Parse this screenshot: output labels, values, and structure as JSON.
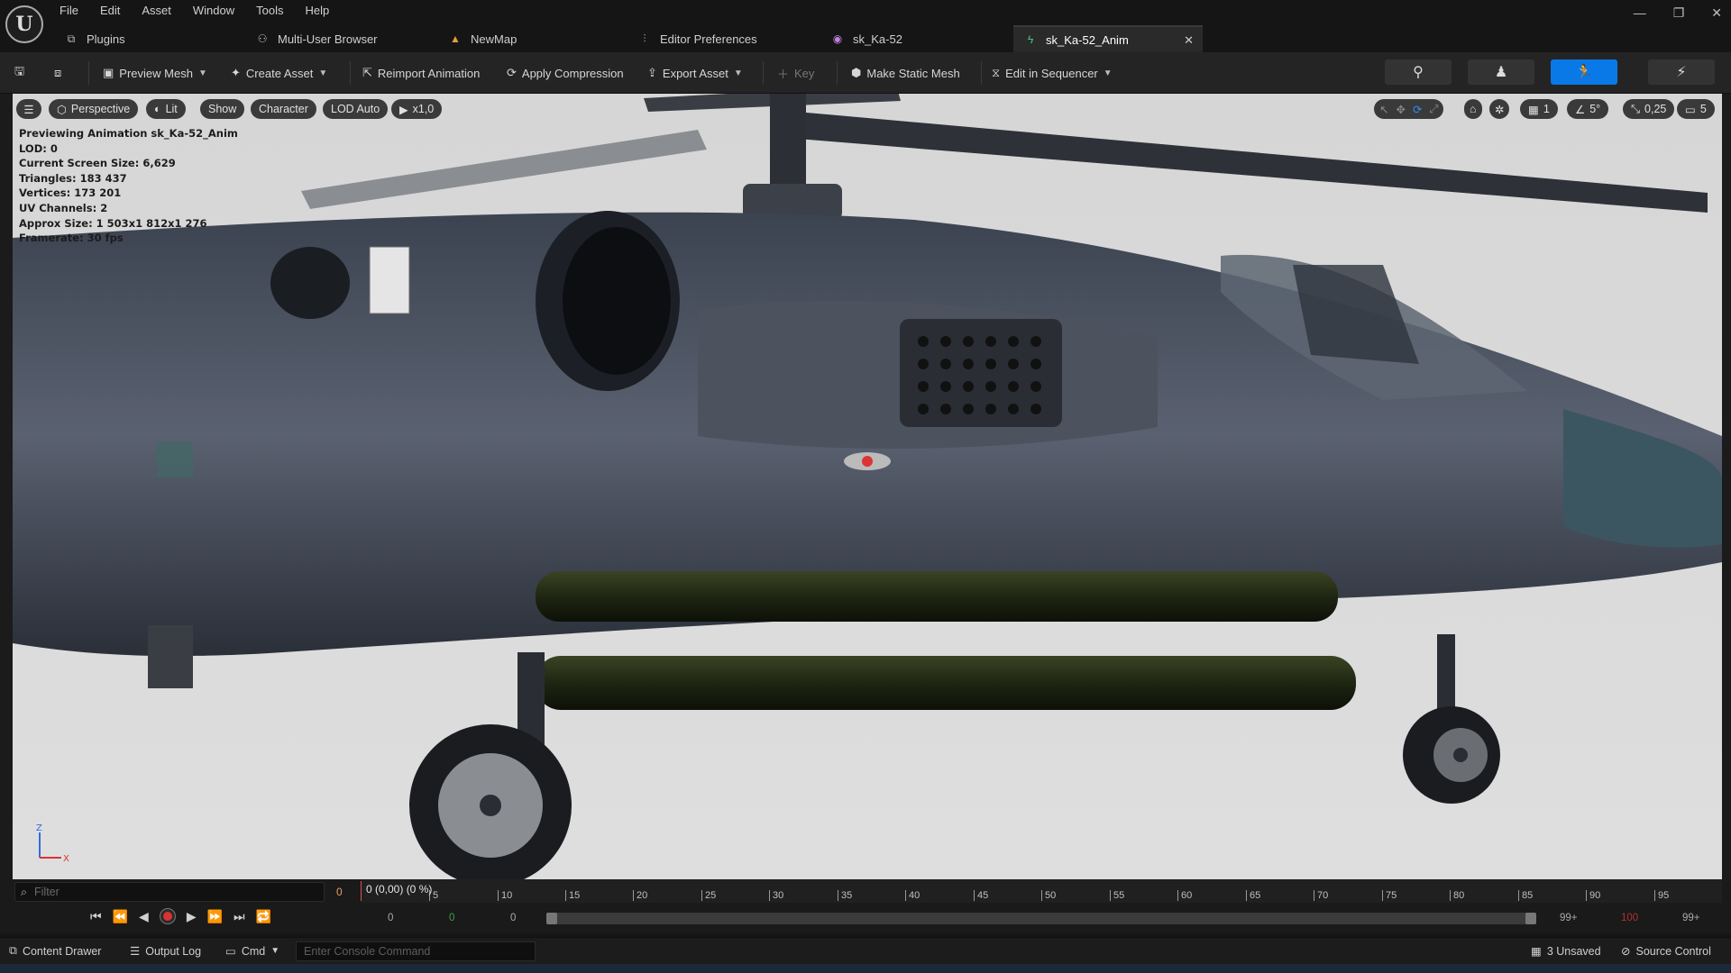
{
  "menu": [
    "File",
    "Edit",
    "Asset",
    "Window",
    "Tools",
    "Help"
  ],
  "tabs": [
    {
      "label": "Plugins",
      "icon": "plugin-icon"
    },
    {
      "label": "Multi-User Browser",
      "icon": "users-icon"
    },
    {
      "label": "NewMap",
      "icon": "map-icon"
    },
    {
      "label": "Editor Preferences",
      "icon": "sliders-icon"
    },
    {
      "label": "sk_Ka-52",
      "icon": "skeleton-icon"
    },
    {
      "label": "sk_Ka-52_Anim",
      "icon": "animation-icon",
      "active": true
    }
  ],
  "toolbar": {
    "preview_mesh": "Preview Mesh",
    "create_asset": "Create Asset",
    "reimport": "Reimport Animation",
    "apply_compression": "Apply Compression",
    "export_asset": "Export Asset",
    "key": "Key",
    "make_static_mesh": "Make Static Mesh",
    "edit_in_sequencer": "Edit in Sequencer"
  },
  "viewport": {
    "perspective": "Perspective",
    "lit": "Lit",
    "show": "Show",
    "character": "Character",
    "lod": "LOD Auto",
    "speed": "x1,0",
    "right_values": {
      "grid": "1",
      "angle": "5°",
      "scale": "0,25",
      "camera": "5"
    },
    "stats": [
      "Previewing Animation sk_Ka-52_Anim",
      "LOD: 0",
      "Current Screen Size: 6,629",
      "Triangles: 183 437",
      "Vertices: 173 201",
      "UV Channels: 2",
      "Approx Size: 1 503x1 812x1 276",
      "Framerate: 30 fps"
    ],
    "axis_z": "Z",
    "axis_x": "X"
  },
  "timeline": {
    "filter_placeholder": "Filter",
    "frame": "0",
    "playhead": "0 (0,00) (0 %)",
    "ticks": [
      "5",
      "10",
      "15",
      "20",
      "25",
      "30",
      "35",
      "40",
      "45",
      "50",
      "55",
      "60",
      "65",
      "70",
      "75",
      "80",
      "85",
      "90",
      "95"
    ],
    "range_start": "0",
    "range_start_green": "0",
    "range_in": "0",
    "range_end_a": "99+",
    "range_end_red": "100",
    "range_end_b": "99+"
  },
  "status": {
    "content_drawer": "Content Drawer",
    "output_log": "Output Log",
    "cmd": "Cmd",
    "console_placeholder": "Enter Console Command",
    "unsaved": "3 Unsaved",
    "source_control": "Source Control"
  },
  "colors": {
    "accent": "#0a79e8",
    "record": "#d93232",
    "viewport_bg": "#d9d9d9"
  }
}
